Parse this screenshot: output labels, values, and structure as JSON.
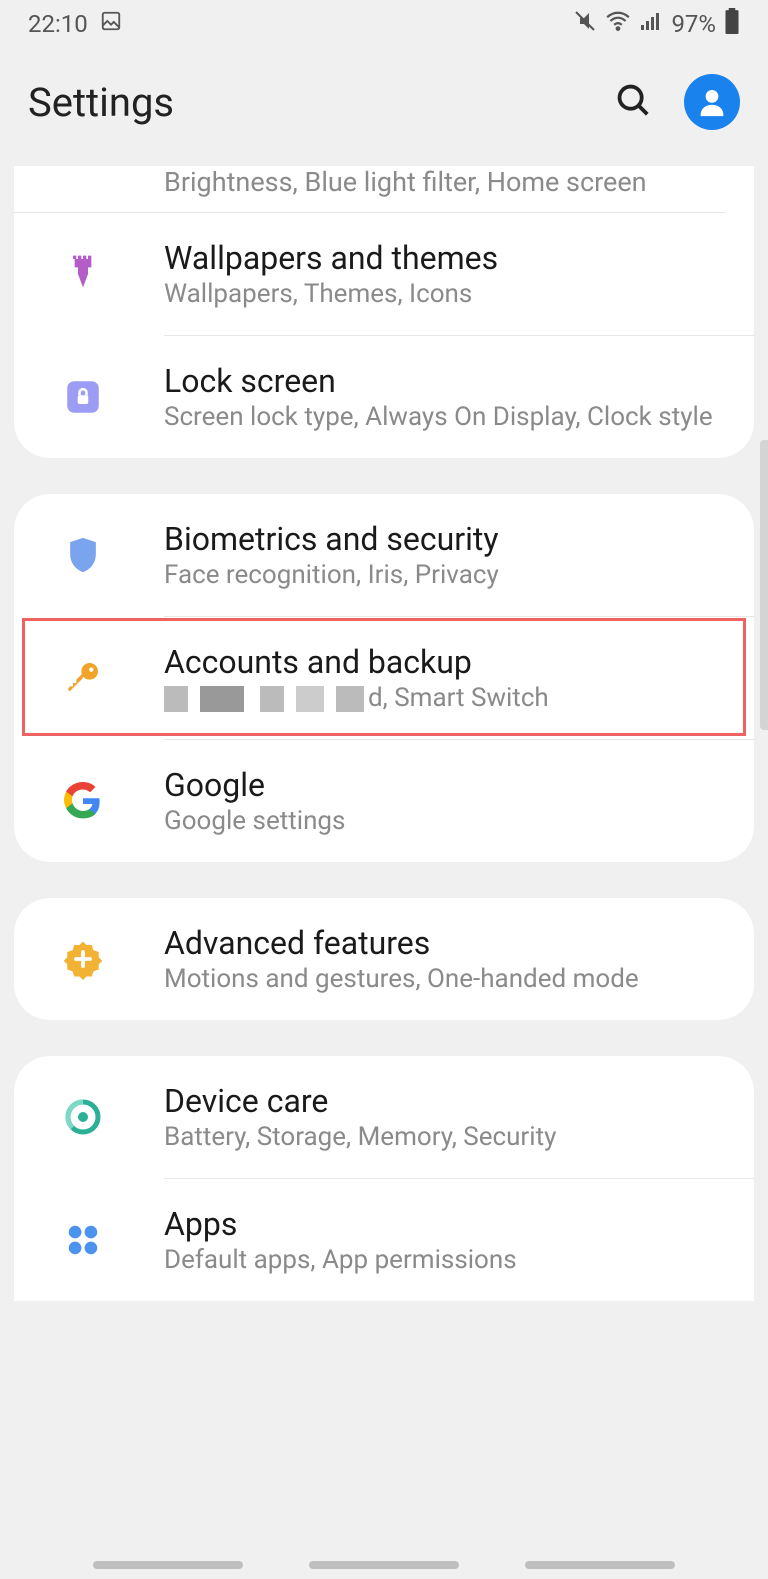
{
  "statusbar": {
    "time": "22:10",
    "battery": "97%"
  },
  "header": {
    "title": "Settings"
  },
  "peek": "Brightness, Blue light filter, Home screen",
  "groups": [
    {
      "items": [
        {
          "title": "Wallpapers and themes",
          "sub": "Wallpapers, Themes, Icons",
          "icon": "brush",
          "color": "#b45cc8"
        },
        {
          "title": "Lock screen",
          "sub": "Screen lock type, Always On Display, Clock style",
          "icon": "lock",
          "color": "#8a8cf7"
        }
      ]
    },
    {
      "items": [
        {
          "title": "Biometrics and security",
          "sub": "Face recognition, Iris, Privacy",
          "icon": "shield",
          "color": "#6b9aed",
          "highlight": true
        },
        {
          "title": "Accounts and backup",
          "sub_suffix": "d, Smart Switch",
          "censored": true,
          "icon": "key",
          "color": "#f0a42a"
        },
        {
          "title": "Google",
          "sub": "Google settings",
          "icon": "google",
          "color": "#4285f4"
        }
      ]
    },
    {
      "items": [
        {
          "title": "Advanced features",
          "sub": "Motions and gestures, One-handed mode",
          "icon": "plus-gear",
          "color": "#f2b233"
        }
      ]
    },
    {
      "items": [
        {
          "title": "Device care",
          "sub": "Battery, Storage, Memory, Security",
          "icon": "radial",
          "color": "#2bb096"
        },
        {
          "title": "Apps",
          "sub": "Default apps, App permissions",
          "icon": "dots",
          "color": "#4286e8"
        }
      ]
    }
  ]
}
